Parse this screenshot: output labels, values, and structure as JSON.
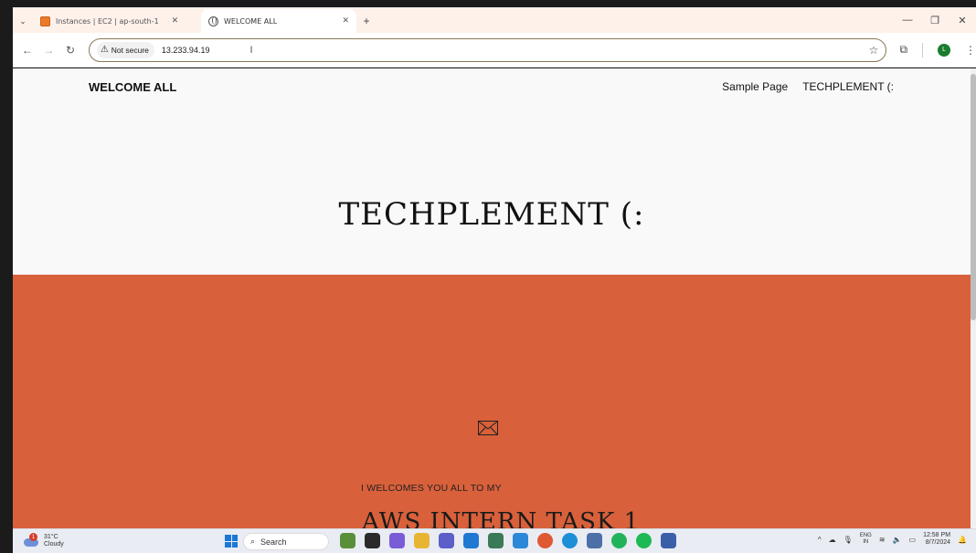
{
  "browser": {
    "tabs": [
      {
        "title": "Instances | EC2 | ap-south-1",
        "active": false
      },
      {
        "title": "WELCOME ALL",
        "active": true
      }
    ],
    "new_tab": "+",
    "address": {
      "security_label": "Not secure",
      "url": "13.233.94.19"
    },
    "profile_initial": "L"
  },
  "page": {
    "site_title": "WELCOME ALL",
    "nav": [
      "Sample Page",
      "TECHPLEMENT (:"
    ],
    "hero_title": "TECHPLEMENT (:",
    "welcome_line": "I WELCOMES YOU ALL TO MY",
    "task_title": "AWS INTERN TASK 1",
    "section_color": "#d8603a"
  },
  "taskbar": {
    "weather_temp": "31°C",
    "weather_desc": "Cloudy",
    "weather_badge": "1",
    "search_label": "Search",
    "lang_line1": "ENG",
    "lang_line2": "IN",
    "time": "12:58 PM",
    "date": "8/7/2024"
  }
}
